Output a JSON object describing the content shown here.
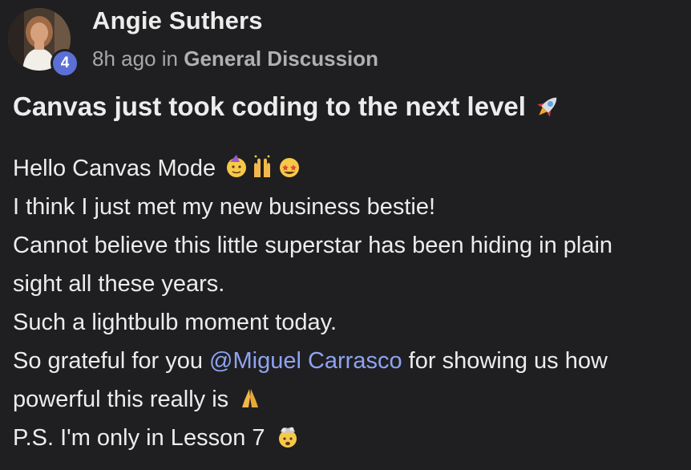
{
  "post": {
    "author": "Angie Suthers",
    "level": "4",
    "time": "8h ago",
    "in_word": "in",
    "category": "General Discussion",
    "title": "Canvas just took coding to the next level",
    "lines": {
      "l1": "Hello Canvas Mode",
      "l2": "I think I just met my new business bestie!",
      "l3": "Cannot believe this little superstar has been hiding in plain",
      "l4": "sight all these years.",
      "l5": "Such a lightbulb moment today.",
      "l6_before": "So grateful for you ",
      "l6_mention": "@Miguel Carrasco",
      "l6_after": " for showing us how",
      "l7": "powerful this really is",
      "l8": "P.S. I'm only in Lesson 7"
    }
  },
  "icons": {
    "title_emoji": "rocket-icon",
    "l1_emojis": [
      "partying-face-icon",
      "raising-hands-icon",
      "star-struck-icon"
    ],
    "l7_emoji": "folded-hands-icon",
    "l8_emoji": "exploding-head-icon"
  },
  "colors": {
    "background": "#1f1f21",
    "text": "#ececec",
    "muted": "#a8a8a8",
    "mention": "#8ea3f0",
    "badge": "#5b6fd6"
  }
}
